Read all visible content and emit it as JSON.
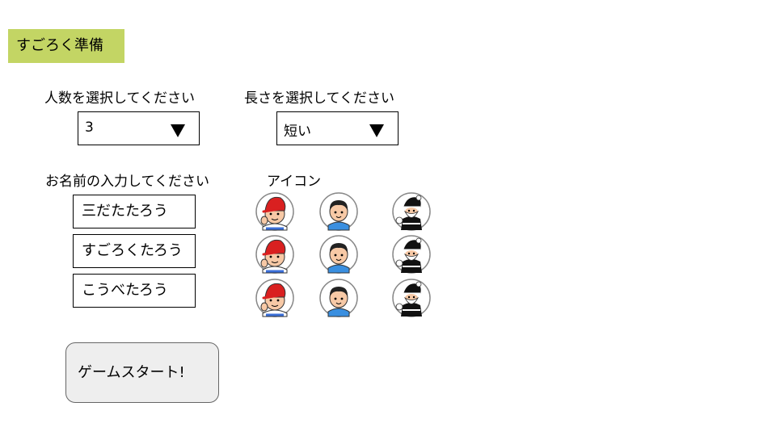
{
  "app": {
    "title": "すごろく準備"
  },
  "players_select": {
    "label": "人数を選択してください",
    "value": "3"
  },
  "length_select": {
    "label": "長さを選択してください",
    "value": "短い"
  },
  "names": {
    "label": "お名前の入力してください",
    "values": [
      "三だたたろう",
      "すごろくたろう",
      "こうべたろう"
    ]
  },
  "icons": {
    "label": "アイコン",
    "types": [
      "red-cap-boy-icon",
      "blue-shirt-boy-icon",
      "santa-figure-icon"
    ]
  },
  "start_button": {
    "label": "ゲームスタート!"
  },
  "colors": {
    "title_bg": "#c3d564",
    "button_bg": "#eeeeee"
  }
}
